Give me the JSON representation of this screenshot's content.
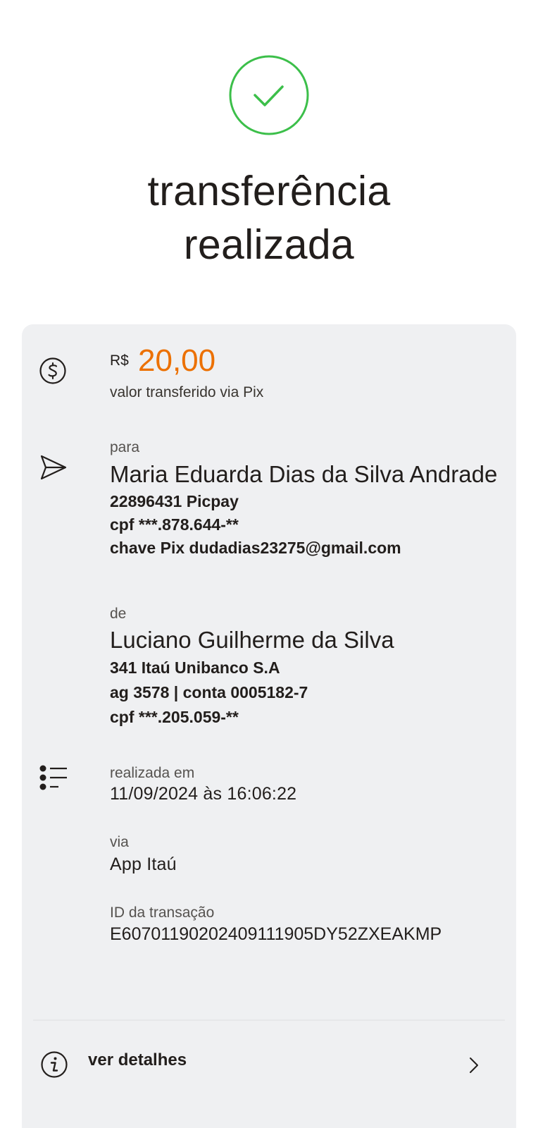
{
  "header": {
    "title_line1": "transferência",
    "title_line2": "realizada",
    "success_color": "#3cbf4a",
    "icon": "check-circle-icon"
  },
  "amount": {
    "currency": "R$",
    "value": "20,00",
    "label": "valor transferido via Pix",
    "accent": "#ec7000",
    "icon": "dollar-circle-icon"
  },
  "recipient": {
    "label": "para",
    "name": "Maria Eduarda Dias da Silva Andrade",
    "bank": "22896431 Picpay",
    "cpf": "cpf ***.878.644-**",
    "pix_key": "chave Pix dudadias23275@gmail.com",
    "icon": "send-icon"
  },
  "sender": {
    "label": "de",
    "name": "Luciano Guilherme da Silva",
    "bank": "341 Itaú Unibanco S.A",
    "account": "ag 3578 | conta 0005182-7",
    "cpf": "cpf ***.205.059-**"
  },
  "transaction": {
    "date_label": "realizada em",
    "date_value": "11/09/2024 às 16:06:22",
    "via_label": "via",
    "via_value": "App Itaú",
    "id_label": "ID da transação",
    "id_value": "E60701190202409111905DY52ZXEAKMP",
    "icon": "list-icon"
  },
  "details": {
    "label": "ver detalhes",
    "icon": "info-icon",
    "chevron": "chevron-right-icon"
  }
}
